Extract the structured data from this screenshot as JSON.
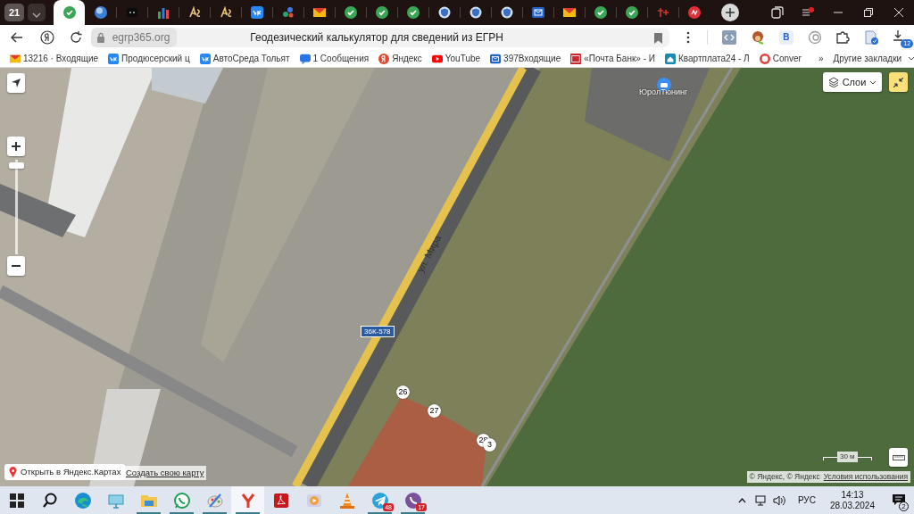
{
  "browser": {
    "tab_count": "21",
    "tabs": [
      {
        "kind": "check",
        "selected": true
      },
      {
        "kind": "globe",
        "selected": false
      },
      {
        "kind": "dark",
        "selected": false
      },
      {
        "kind": "chart",
        "selected": false
      },
      {
        "kind": "script",
        "selected": false
      },
      {
        "kind": "script",
        "selected": false
      },
      {
        "kind": "vk",
        "selected": false
      },
      {
        "kind": "dots",
        "selected": false
      },
      {
        "kind": "mail",
        "selected": false
      },
      {
        "kind": "check",
        "selected": false
      },
      {
        "kind": "check",
        "selected": false
      },
      {
        "kind": "check",
        "selected": false
      },
      {
        "kind": "shield",
        "selected": false
      },
      {
        "kind": "shield",
        "selected": false
      },
      {
        "kind": "shield",
        "selected": false
      },
      {
        "kind": "envelope",
        "selected": false
      },
      {
        "kind": "mail",
        "selected": false
      },
      {
        "kind": "check",
        "selected": false
      },
      {
        "kind": "check",
        "selected": false
      },
      {
        "kind": "cross",
        "selected": false
      },
      {
        "kind": "circle",
        "selected": false
      }
    ]
  },
  "address_bar": {
    "url": "egrp365.org",
    "page_title": "Геодезический калькулятор для сведений из ЕГРН"
  },
  "extensions": [
    {
      "kind": "code"
    },
    {
      "kind": "avatar"
    },
    {
      "kind": "letter",
      "label": "B"
    },
    {
      "kind": "swirl"
    },
    {
      "kind": "puzzle"
    },
    {
      "kind": "doc"
    },
    {
      "kind": "download",
      "badge": "12"
    }
  ],
  "bookmarks": [
    {
      "kind": "mail",
      "label": "13216 · Входящие"
    },
    {
      "kind": "vk",
      "label": "Продюсерский ц"
    },
    {
      "kind": "vk",
      "label": "АвтоСреда Тольят"
    },
    {
      "kind": "chat",
      "label": "1 Сообщения"
    },
    {
      "kind": "ya",
      "label": "Яндекс"
    },
    {
      "kind": "play",
      "label": "YouTube"
    },
    {
      "kind": "envelope",
      "label": "397Входящие"
    },
    {
      "kind": "bank",
      "label": "«Почта Банк» - И"
    },
    {
      "kind": "house",
      "label": "Квартплата24 - Л"
    },
    {
      "kind": "ring",
      "label": "Conver"
    }
  ],
  "bookmarks_more": "»",
  "other_bookmarks": "Другие закладки",
  "map": {
    "zoom": {
      "level": 0.97
    },
    "layers_button": "Слои",
    "poi_label": "ЮролТюнинг",
    "road_name": "ул. Мира",
    "road_number": "36К-578",
    "points": [
      {
        "label": "26"
      },
      {
        "label": "27"
      },
      {
        "label": "28"
      },
      {
        "label": "3"
      }
    ],
    "open_link": "Открыть в Яндекс.Картах",
    "create_link": "Создать свою карту",
    "scale": "30 м",
    "copyright": "© Яндекс, © Яндекс",
    "terms_link": "Условия использования"
  },
  "taskbar": {
    "apps": [
      {
        "kind": "windows",
        "running": false,
        "selected": false
      },
      {
        "kind": "search",
        "running": false,
        "selected": false
      },
      {
        "kind": "edge",
        "running": false,
        "selected": false
      },
      {
        "kind": "monitor",
        "running": false,
        "selected": false
      },
      {
        "kind": "folder",
        "running": true,
        "selected": false
      },
      {
        "kind": "whatsapp",
        "running": true,
        "selected": false
      },
      {
        "kind": "paint",
        "running": true,
        "selected": false
      },
      {
        "kind": "yandex",
        "running": true,
        "selected": true
      },
      {
        "kind": "pdf",
        "running": false,
        "selected": false
      },
      {
        "kind": "video",
        "running": false,
        "selected": false
      },
      {
        "kind": "cone",
        "running": false,
        "selected": false
      },
      {
        "kind": "telegram",
        "running": true,
        "selected": false,
        "badge": "48"
      },
      {
        "kind": "viber",
        "running": true,
        "selected": false,
        "badge": "17"
      }
    ],
    "language": "РУС",
    "time": "14:13",
    "date": "28.03.2024",
    "notifications": "2"
  }
}
